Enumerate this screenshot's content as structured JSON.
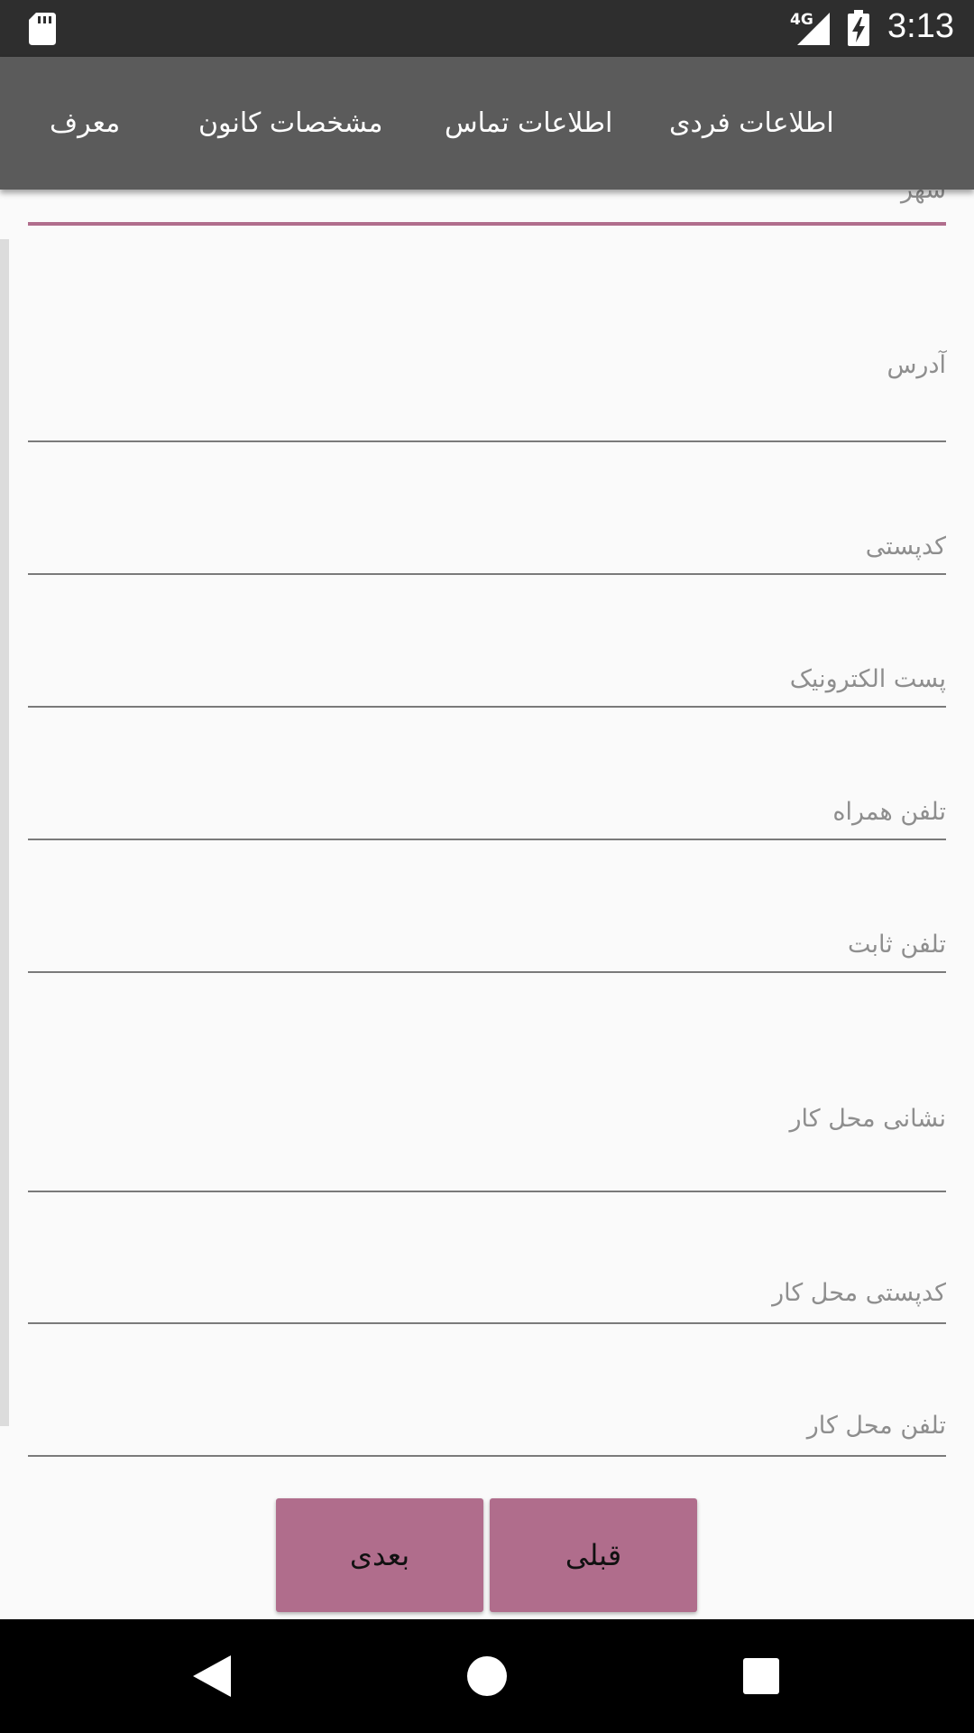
{
  "status_bar": {
    "network": "4G",
    "time": "3:13",
    "icons": [
      "sd-card-icon",
      "signal-icon",
      "battery-charging-icon"
    ]
  },
  "tabs": [
    {
      "label": "اطلاعات فردی"
    },
    {
      "label": "اطلاعات تماس"
    },
    {
      "label": "مشخصات کانون"
    },
    {
      "label": "معرف"
    }
  ],
  "form": {
    "fields": [
      {
        "label": "شهر"
      },
      {
        "label": "آدرس"
      },
      {
        "label": "کدپستی"
      },
      {
        "label": "پست الکترونیک"
      },
      {
        "label": "تلفن همراه"
      },
      {
        "label": "تلفن ثابت"
      },
      {
        "label": "نشانی محل کار"
      },
      {
        "label": "کدپستی محل کار"
      },
      {
        "label": "تلفن محل کار"
      }
    ]
  },
  "buttons": {
    "next_label": "بعدی",
    "prev_label": "قبلی"
  },
  "colors": {
    "accent": "#b06d8c",
    "tab_bar": "#5b5b5b",
    "status_bar": "#2e2e2e"
  },
  "nav_bar": {
    "icons": [
      "back-icon",
      "home-icon",
      "recents-icon"
    ]
  }
}
